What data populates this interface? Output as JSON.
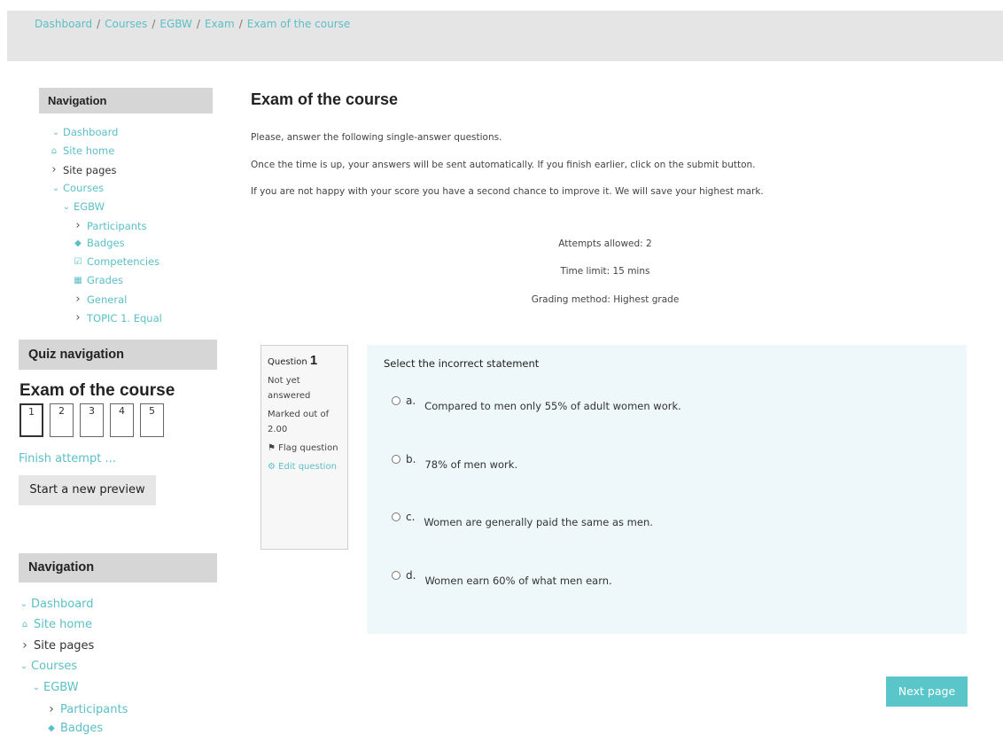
{
  "breadcrumb": [
    "Dashboard",
    "Courses",
    "EGBW",
    "Exam",
    "Exam of the course"
  ],
  "nav1": {
    "title": "Navigation",
    "items": [
      {
        "label": "Dashboard",
        "icon": "chevron-down-icon",
        "glyph": "⌄",
        "link": true
      },
      {
        "label": "Site home",
        "icon": "home-icon",
        "glyph": "⌂",
        "link": true
      },
      {
        "label": "Site pages",
        "icon": "chevron-right-icon",
        "glyph": "›",
        "link": false
      },
      {
        "label": "Courses",
        "icon": "chevron-down-icon",
        "glyph": "⌄",
        "link": true
      },
      {
        "label": "EGBW",
        "icon": "chevron-down-icon",
        "glyph": "⌄",
        "link": true
      },
      {
        "label": "Participants",
        "icon": "chevron-right-icon",
        "glyph": "›",
        "link": true
      },
      {
        "label": "Badges",
        "icon": "shield-icon",
        "glyph": "◆",
        "link": true
      },
      {
        "label": "Competencies",
        "icon": "checkbox-icon",
        "glyph": "☑",
        "link": true
      },
      {
        "label": "Grades",
        "icon": "table-icon",
        "glyph": "▦",
        "link": true
      },
      {
        "label": "General",
        "icon": "chevron-right-icon",
        "glyph": "›",
        "link": true
      },
      {
        "label": "TOPIC 1. Equal",
        "icon": "chevron-right-icon",
        "glyph": "›",
        "link": true
      }
    ]
  },
  "quiz_nav": {
    "title": "Quiz navigation",
    "quiz_title": "Exam of the course",
    "buttons": [
      "1",
      "2",
      "3",
      "4",
      "5"
    ],
    "finish_label": "Finish attempt ...",
    "preview_label": "Start a new preview"
  },
  "nav2": {
    "title": "Navigation",
    "items": [
      {
        "label": "Dashboard",
        "icon": "chevron-down-icon",
        "glyph": "⌄",
        "link": true
      },
      {
        "label": "Site home",
        "icon": "home-icon",
        "glyph": "⌂",
        "link": true
      },
      {
        "label": "Site pages",
        "icon": "chevron-right-icon",
        "glyph": "›",
        "link": false
      },
      {
        "label": "Courses",
        "icon": "chevron-down-icon",
        "glyph": "⌄",
        "link": true
      },
      {
        "label": "EGBW",
        "icon": "chevron-down-icon",
        "glyph": "⌄",
        "link": true
      },
      {
        "label": "Participants",
        "icon": "chevron-right-icon",
        "glyph": "›",
        "link": true
      },
      {
        "label": "Badges",
        "icon": "shield-icon",
        "glyph": "◆",
        "link": true
      }
    ]
  },
  "main": {
    "title": "Exam of the course",
    "intro": [
      "Please, answer the following single-answer questions.",
      "Once the time is up, your answers will be sent automatically. If you finish earlier, click on the submit button.",
      "If you are not happy with your score you have a second chance to improve it. We will save your highest mark."
    ],
    "attempts": "Attempts allowed: 2",
    "time_limit": "Time limit: 15 mins",
    "grading": "Grading method: Highest grade"
  },
  "question": {
    "label": "Question",
    "number": "1",
    "status": "Not yet answered",
    "marks": "Marked out of 2.00",
    "flag": "Flag question",
    "edit": "Edit question",
    "prompt": "Select the incorrect statement",
    "answers": [
      {
        "letter": "a.",
        "text": "Compared to men only 55% of adult women work."
      },
      {
        "letter": "b.",
        "text": "78% of men work."
      },
      {
        "letter": "c.",
        "text": "Women are generally paid the same as men."
      },
      {
        "letter": "d.",
        "text": "Women earn 60% of what men earn."
      }
    ]
  },
  "next_label": "Next page",
  "colors": {
    "accent": "#5bbfc7",
    "button": "#5bc6c9"
  }
}
